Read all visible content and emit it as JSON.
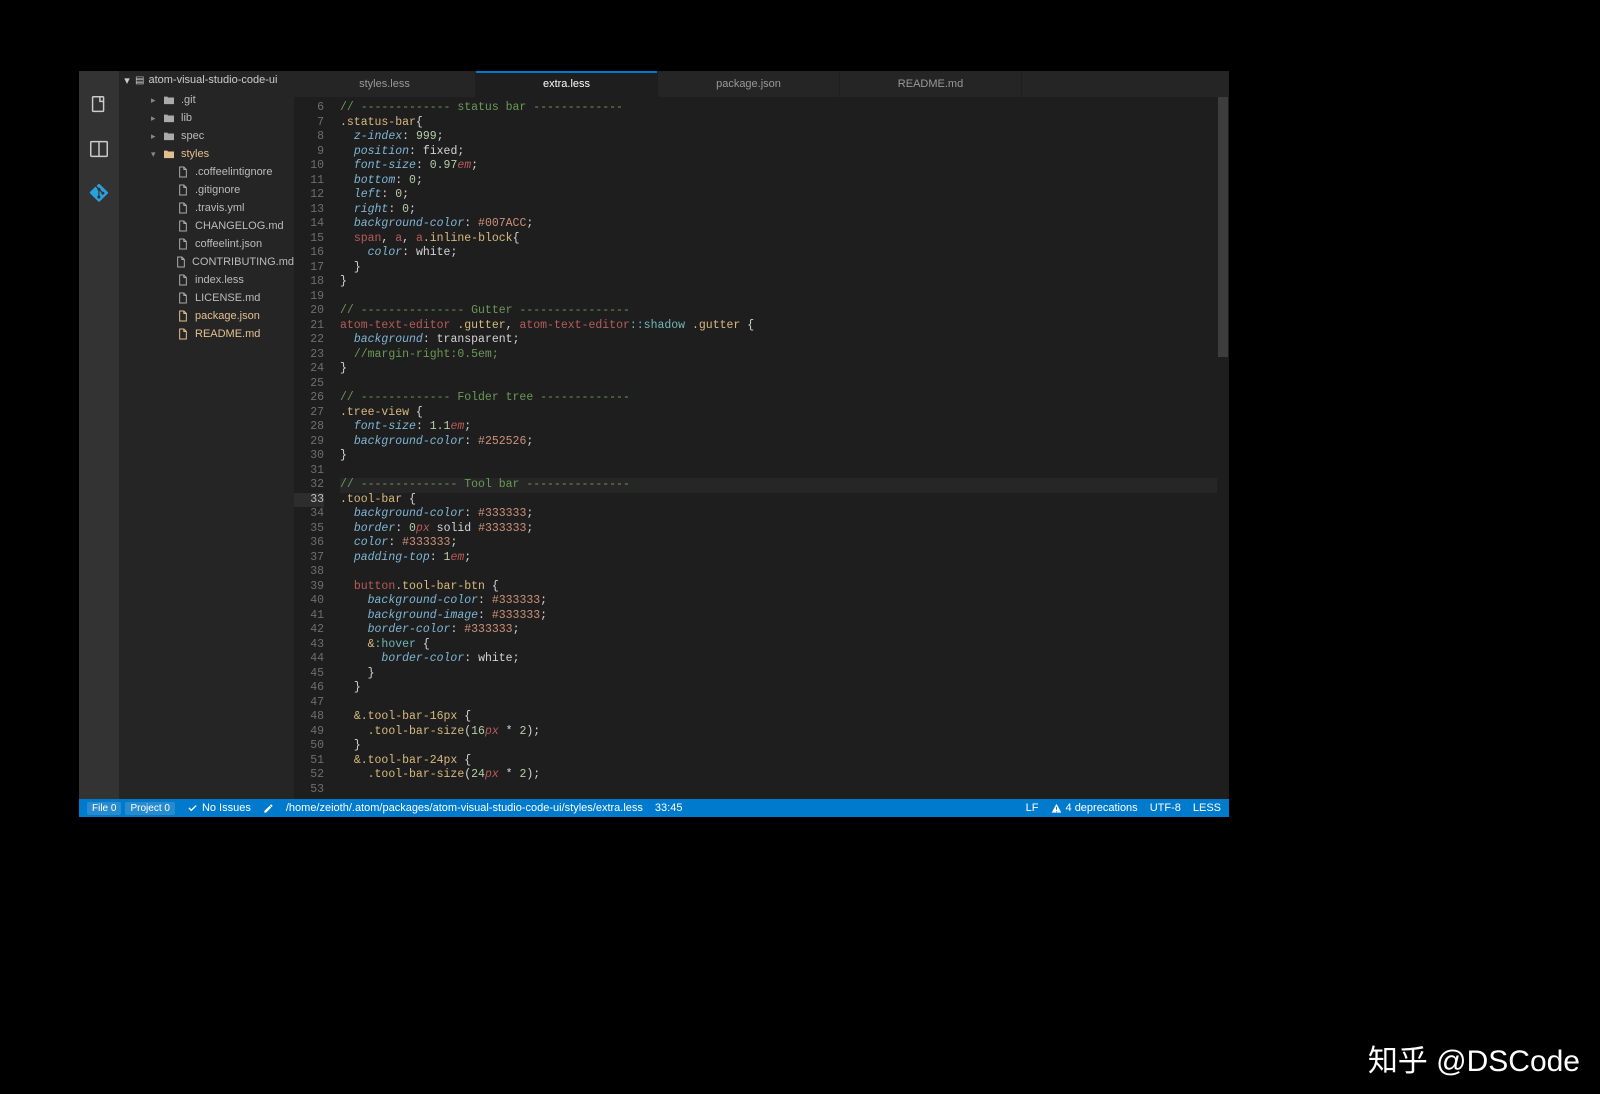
{
  "project": {
    "name": "atom-visual-studio-code-ui"
  },
  "tree": [
    {
      "depth": 1,
      "kind": "folder",
      "label": ".git",
      "collapsed": true
    },
    {
      "depth": 1,
      "kind": "folder",
      "label": "lib",
      "collapsed": true
    },
    {
      "depth": 1,
      "kind": "folder",
      "label": "spec",
      "collapsed": true
    },
    {
      "depth": 1,
      "kind": "folder",
      "label": "styles",
      "collapsed": false,
      "mod": true
    },
    {
      "depth": 2,
      "kind": "file",
      "label": ".coffeelintignore"
    },
    {
      "depth": 2,
      "kind": "file",
      "label": ".gitignore"
    },
    {
      "depth": 2,
      "kind": "file",
      "label": ".travis.yml"
    },
    {
      "depth": 2,
      "kind": "file",
      "label": "CHANGELOG.md"
    },
    {
      "depth": 2,
      "kind": "file",
      "label": "coffeelint.json"
    },
    {
      "depth": 2,
      "kind": "file",
      "label": "CONTRIBUTING.md"
    },
    {
      "depth": 2,
      "kind": "file",
      "label": "index.less"
    },
    {
      "depth": 2,
      "kind": "file",
      "label": "LICENSE.md"
    },
    {
      "depth": 2,
      "kind": "file",
      "label": "package.json",
      "mod": true
    },
    {
      "depth": 2,
      "kind": "file",
      "label": "README.md",
      "mod": true
    }
  ],
  "tabs": [
    {
      "label": "styles.less",
      "active": false
    },
    {
      "label": "extra.less",
      "active": true
    },
    {
      "label": "package.json",
      "active": false
    },
    {
      "label": "README.md",
      "active": false
    }
  ],
  "gutter": {
    "start": 6,
    "end": 53,
    "current": 33
  },
  "code": [
    {
      "h": "<span class='c-com'>// ------------- status bar -------------</span>"
    },
    {
      "h": "<span class='c-sel'>.status-bar</span><span class='c-pnc'>{</span>"
    },
    {
      "h": "  <span class='c-prop'>z-index</span><span class='c-pnc'>: </span><span class='c-num'>999</span><span class='c-pnc'>;</span>"
    },
    {
      "h": "  <span class='c-prop'>position</span><span class='c-pnc'>: </span><span class='c-val'>fixed</span><span class='c-pnc'>;</span>"
    },
    {
      "h": "  <span class='c-prop'>font-size</span><span class='c-pnc'>: </span><span class='c-num'>0.97</span><span class='c-unit'>em</span><span class='c-pnc'>;</span>"
    },
    {
      "h": "  <span class='c-prop'>bottom</span><span class='c-pnc'>: </span><span class='c-num'>0</span><span class='c-pnc'>;</span>"
    },
    {
      "h": "  <span class='c-prop'>left</span><span class='c-pnc'>: </span><span class='c-num'>0</span><span class='c-pnc'>;</span>"
    },
    {
      "h": "  <span class='c-prop'>right</span><span class='c-pnc'>: </span><span class='c-num'>0</span><span class='c-pnc'>;</span>"
    },
    {
      "h": "  <span class='c-prop'>background-color</span><span class='c-pnc'>: </span><span class='c-hash'>#007ACC</span><span class='c-pnc'>;</span>"
    },
    {
      "h": "  <span class='c-tag'>span</span><span class='c-pnc'>, </span><span class='c-tag'>a</span><span class='c-pnc'>, </span><span class='c-tag'>a</span><span class='c-sel'>.inline-block</span><span class='c-pnc'>{</span>"
    },
    {
      "h": "    <span class='c-prop'>color</span><span class='c-pnc'>: </span><span class='c-val'>white</span><span class='c-pnc'>;</span>"
    },
    {
      "h": "  <span class='c-pnc'>}</span>"
    },
    {
      "h": "<span class='c-pnc'>}</span>"
    },
    {
      "h": ""
    },
    {
      "h": "<span class='c-com'>// --------------- Gutter ----------------</span>"
    },
    {
      "h": "<span class='c-tag'>atom-text-editor</span> <span class='c-sel'>.gutter</span><span class='c-pnc'>, </span><span class='c-tag'>atom-text-editor</span><span class='c-pseudo'>::shadow</span> <span class='c-sel'>.gutter</span> <span class='c-pnc'>{</span>"
    },
    {
      "h": "  <span class='c-prop'>background</span><span class='c-pnc'>: </span><span class='c-val'>transparent</span><span class='c-pnc'>;</span>"
    },
    {
      "h": "  <span class='c-com'>//margin-right:0.5em;</span>"
    },
    {
      "h": "<span class='c-pnc'>}</span>"
    },
    {
      "h": ""
    },
    {
      "h": "<span class='c-com'>// ------------- Folder tree -------------</span>"
    },
    {
      "h": "<span class='c-sel'>.tree-view</span> <span class='c-pnc'>{</span>"
    },
    {
      "h": "  <span class='c-prop'>font-size</span><span class='c-pnc'>: </span><span class='c-num'>1.1</span><span class='c-unit'>em</span><span class='c-pnc'>;</span>"
    },
    {
      "h": "  <span class='c-prop'>background-color</span><span class='c-pnc'>: </span><span class='c-hash'>#252526</span><span class='c-pnc'>;</span>"
    },
    {
      "h": "<span class='c-pnc'>}</span>"
    },
    {
      "h": ""
    },
    {
      "h": "<span class='c-com'>// -------------- Tool bar ---------------</span>",
      "cur": true
    },
    {
      "h": "<span class='c-sel'>.tool-bar</span> <span class='c-pnc'>{</span>"
    },
    {
      "h": "  <span class='c-prop'>background-color</span><span class='c-pnc'>: </span><span class='c-hash'>#333333</span><span class='c-pnc'>;</span>"
    },
    {
      "h": "  <span class='c-prop'>border</span><span class='c-pnc'>: </span><span class='c-num'>0</span><span class='c-unit'>px</span><span class='c-val'> solid </span><span class='c-hash'>#333333</span><span class='c-pnc'>;</span>"
    },
    {
      "h": "  <span class='c-prop'>color</span><span class='c-pnc'>: </span><span class='c-hash'>#333333</span><span class='c-pnc'>;</span>"
    },
    {
      "h": "  <span class='c-prop'>padding-top</span><span class='c-pnc'>: </span><span class='c-num'>1</span><span class='c-unit'>em</span><span class='c-pnc'>;</span>"
    },
    {
      "h": ""
    },
    {
      "h": "  <span class='c-tag'>button</span><span class='c-sel'>.tool-bar-btn</span> <span class='c-pnc'>{</span>"
    },
    {
      "h": "    <span class='c-prop'>background-color</span><span class='c-pnc'>: </span><span class='c-hash'>#333333</span><span class='c-pnc'>;</span>"
    },
    {
      "h": "    <span class='c-prop'>background-image</span><span class='c-pnc'>: </span><span class='c-hash'>#333333</span><span class='c-pnc'>;</span>"
    },
    {
      "h": "    <span class='c-prop'>border-color</span><span class='c-pnc'>: </span><span class='c-hash'>#333333</span><span class='c-pnc'>;</span>"
    },
    {
      "h": "    <span class='c-sel'>&amp;</span><span class='c-pseudo'>:hover</span> <span class='c-pnc'>{</span>"
    },
    {
      "h": "      <span class='c-prop'>border-color</span><span class='c-pnc'>: </span><span class='c-val'>white</span><span class='c-pnc'>;</span>"
    },
    {
      "h": "    <span class='c-pnc'>}</span>"
    },
    {
      "h": "  <span class='c-pnc'>}</span>"
    },
    {
      "h": ""
    },
    {
      "h": "  <span class='c-sel'>&amp;.tool-bar-16px</span> <span class='c-pnc'>{</span>"
    },
    {
      "h": "    <span class='c-sel'>.tool-bar-size</span><span class='c-pnc'>(</span><span class='c-num'>16</span><span class='c-unit'>px</span><span class='c-pnc'> * </span><span class='c-num'>2</span><span class='c-pnc'>);</span>"
    },
    {
      "h": "  <span class='c-pnc'>}</span>"
    },
    {
      "h": "  <span class='c-sel'>&amp;.tool-bar-24px</span> <span class='c-pnc'>{</span>"
    },
    {
      "h": "    <span class='c-sel'>.tool-bar-size</span><span class='c-pnc'>(</span><span class='c-num'>24</span><span class='c-unit'>px</span><span class='c-pnc'> * </span><span class='c-num'>2</span><span class='c-pnc'>);</span>"
    }
  ],
  "status": {
    "file_label": "File",
    "file_count": "0",
    "project_label": "Project",
    "project_count": "0",
    "issues": "No Issues",
    "path": "/home/zeioth/.atom/packages/atom-visual-studio-code-ui/styles/extra.less",
    "cursor": "33:45",
    "line_ending": "LF",
    "deprecations": "4 deprecations",
    "encoding": "UTF-8",
    "grammar": "LESS"
  },
  "watermark": "知乎 @DSCode"
}
